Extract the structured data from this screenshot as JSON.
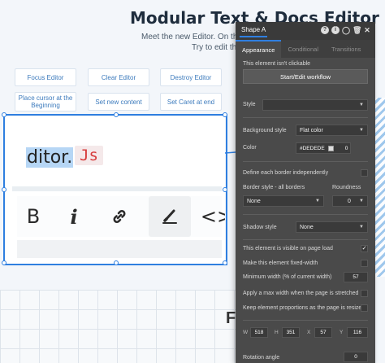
{
  "page": {
    "title": "Modular Text & Docs Editor",
    "subtitle_1": "Meet the new Editor. On this",
    "subtitle_2": "Try to edit the",
    "bottom_letter": "F"
  },
  "canvas_buttons": {
    "focus": "Focus Editor",
    "clear": "Clear Editor",
    "destroy": "Destroy Editor",
    "place_cursor": "Place cursor at the Beginning",
    "set_content": "Set new content",
    "set_caret": "Set Caret at end"
  },
  "editor": {
    "text": "ditor.",
    "code": "Js",
    "toolbar": {
      "bold": "B",
      "italic": "i",
      "link": "link-icon",
      "highlight": "brush-icon",
      "code": "<>"
    }
  },
  "panel": {
    "element_name": "Shape A",
    "header_icons": [
      "help-icon",
      "info-icon",
      "comment-icon",
      "delete-icon",
      "close-icon"
    ],
    "tabs": [
      "Appearance",
      "Conditional",
      "Transitions"
    ],
    "active_tab": "Appearance",
    "not_clickable": "This element isn't clickable",
    "workflow_button": "Start/Edit workflow",
    "style_label": "Style",
    "style_value": "",
    "bg_style_label": "Background style",
    "bg_style_value": "Flat color",
    "color_label": "Color",
    "color_value": "#DEDEDE",
    "color_opacity": "0",
    "define_borders": "Define each border independently",
    "border_style_label": "Border style - all borders",
    "border_style_value": "None",
    "roundness_label": "Roundness",
    "roundness_value": "0",
    "shadow_label": "Shadow style",
    "shadow_value": "None",
    "visible_on_load": "This element is visible on page load",
    "fixed_width": "Make this element fixed-width",
    "min_width_label": "Minimum width (% of current width)",
    "min_width_value": "57",
    "max_width": "Apply a max width when the page is stretched",
    "keep_proportions": "Keep element proportions as the page is resized",
    "dims": {
      "w_label": "W",
      "w": "518",
      "h_label": "H",
      "h": "351",
      "x_label": "X",
      "x": "57",
      "y_label": "Y",
      "y": "116"
    },
    "rotation_label": "Rotation angle",
    "rotation_value": "0"
  },
  "colors": {
    "accent": "#2f7fe0",
    "panel_bg": "#4a4a4a",
    "button_text": "#3d7bbd",
    "code_red": "#d63a3a",
    "highlight": "#b6d6f5"
  }
}
